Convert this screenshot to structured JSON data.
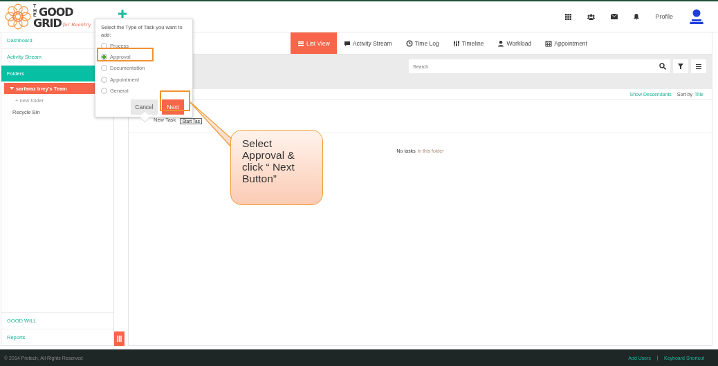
{
  "header": {
    "logo": {
      "small": "THE",
      "top": "GOOD",
      "bottom": "GRID",
      "tagline": "for Reentry"
    },
    "profile_label": "Profile"
  },
  "sidebar": {
    "items": [
      {
        "label": "Dashboard",
        "kind": "link",
        "selected": false
      },
      {
        "label": "Activity Stream",
        "kind": "link",
        "selected": false
      },
      {
        "label": "Folders",
        "kind": "section",
        "selected": true
      },
      {
        "label": "sarfaraz brey's Team",
        "kind": "team",
        "selected": true
      },
      {
        "label": "+ new folder",
        "kind": "add",
        "selected": false
      },
      {
        "label": "Recycle Bin",
        "kind": "folder",
        "selected": false
      }
    ],
    "bottom_items": [
      {
        "label": "GOOD WILL"
      },
      {
        "label": "Reports"
      }
    ]
  },
  "popup": {
    "prompt": "Select the Type of Task you want to add:",
    "options": [
      {
        "label": "Process",
        "selected": false
      },
      {
        "label": "Approval",
        "selected": true
      },
      {
        "label": "Documentation",
        "selected": false
      },
      {
        "label": "Appointment",
        "selected": false
      },
      {
        "label": "General",
        "selected": false
      }
    ],
    "cancel": "Cancel",
    "next": "Next"
  },
  "tabs": [
    {
      "label": "List View",
      "selected": true
    },
    {
      "label": "Activity Stream",
      "selected": false
    },
    {
      "label": "Time Log",
      "selected": false
    },
    {
      "label": "Timeline",
      "selected": false
    },
    {
      "label": "Workload",
      "selected": false
    },
    {
      "label": "Appointment",
      "selected": false
    }
  ],
  "search": {
    "placeholder": "Search"
  },
  "list_options": {
    "show_descendants": "Show Descendants",
    "sort_by": "Sort by",
    "sort_field": "Title"
  },
  "new_task": "New Task",
  "tooltip": "Start Tas",
  "empty": {
    "text": "No tasks",
    "link": "in this folder"
  },
  "callout": "Select Approval & click “ Next Button”",
  "footer": {
    "copyright": "© 2014 Protech, All Rights Reserved",
    "links": [
      "Add Users",
      "Keyboard Shortcut"
    ]
  }
}
